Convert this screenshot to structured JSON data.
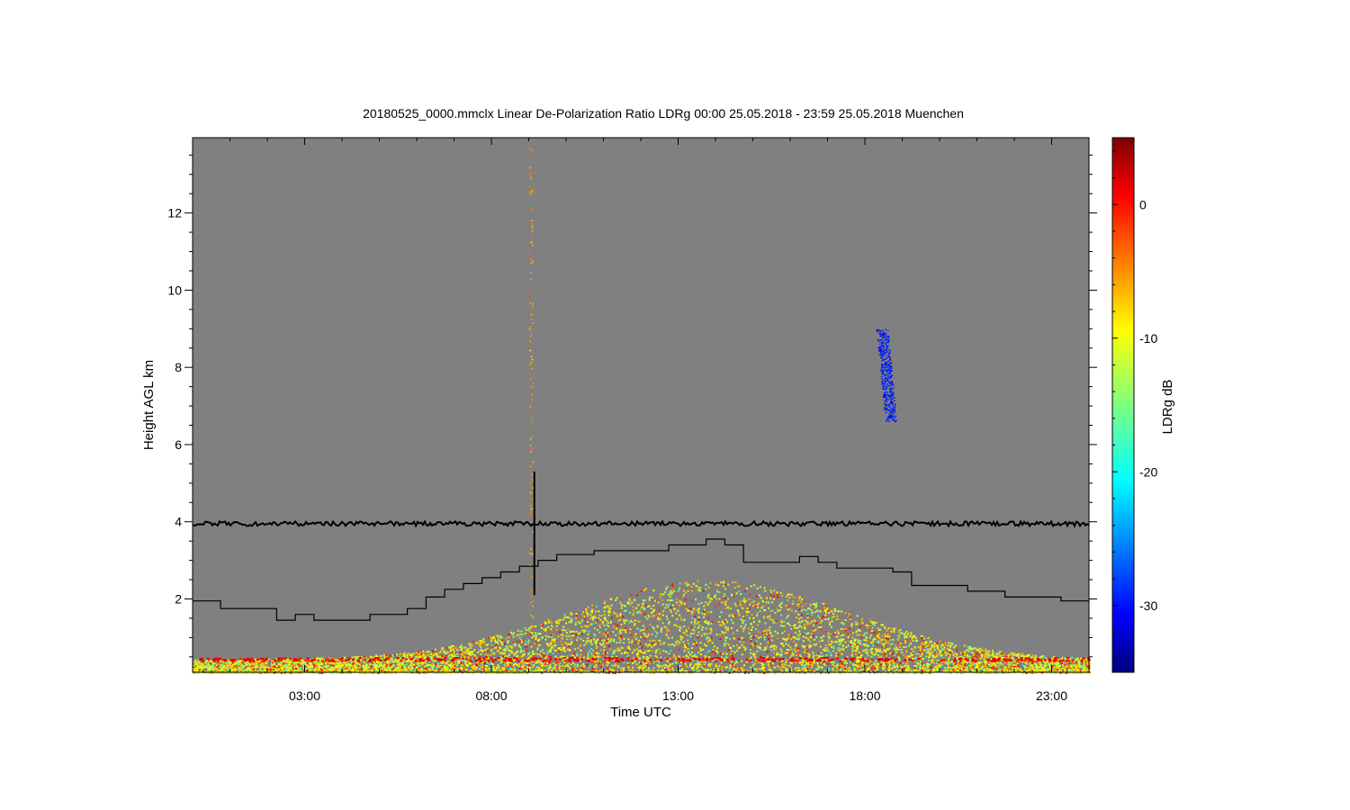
{
  "chart_data": {
    "type": "heatmap",
    "title": "20180525_0000.mmclx Linear De-Polarization Ratio LDRg   00:00 25.05.2018 - 23:59 25.05.2018 Muenchen",
    "xlabel": "Time UTC",
    "ylabel": "Height AGL km",
    "colorbar_label": "LDRg dB",
    "xlim_hours": [
      0.0,
      24.0
    ],
    "ylim_km": [
      0.1,
      13.95
    ],
    "x_ticks": [
      {
        "hours": 3,
        "label": "03:00"
      },
      {
        "hours": 8,
        "label": "08:00"
      },
      {
        "hours": 13,
        "label": "13:00"
      },
      {
        "hours": 18,
        "label": "18:00"
      },
      {
        "hours": 23,
        "label": "23:00"
      }
    ],
    "y_ticks": [
      {
        "km": 2,
        "label": "2"
      },
      {
        "km": 4,
        "label": "4"
      },
      {
        "km": 6,
        "label": "6"
      },
      {
        "km": 8,
        "label": "8"
      },
      {
        "km": 10,
        "label": "10"
      },
      {
        "km": 12,
        "label": "12"
      }
    ],
    "colorbar": {
      "range_db": [
        -35,
        5
      ],
      "ticks": [
        {
          "value": 0,
          "label": "0"
        },
        {
          "value": -10,
          "label": "-10"
        },
        {
          "value": -20,
          "label": "-20"
        },
        {
          "value": -30,
          "label": "-30"
        }
      ],
      "colormap": "jet"
    },
    "background_color": "#808080",
    "noise_line_km": 3.95,
    "boundary_layer_step_km": [
      [
        0.0,
        1.95
      ],
      [
        0.75,
        1.75
      ],
      [
        2.25,
        1.45
      ],
      [
        2.75,
        1.6
      ],
      [
        3.25,
        1.45
      ],
      [
        4.75,
        1.6
      ],
      [
        5.75,
        1.75
      ],
      [
        6.25,
        2.05
      ],
      [
        6.75,
        2.25
      ],
      [
        7.25,
        2.4
      ],
      [
        7.75,
        2.55
      ],
      [
        8.25,
        2.7
      ],
      [
        8.75,
        2.85
      ],
      [
        9.25,
        3.0
      ],
      [
        9.75,
        3.15
      ],
      [
        10.75,
        3.25
      ],
      [
        12.75,
        3.4
      ],
      [
        13.75,
        3.55
      ],
      [
        14.25,
        3.4
      ],
      [
        14.75,
        2.95
      ],
      [
        16.25,
        3.1
      ],
      [
        16.75,
        2.95
      ],
      [
        17.25,
        2.8
      ],
      [
        18.75,
        2.7
      ],
      [
        19.25,
        2.35
      ],
      [
        20.75,
        2.2
      ],
      [
        21.75,
        2.05
      ],
      [
        23.25,
        1.95
      ],
      [
        24.0,
        1.95
      ]
    ],
    "spike_hour": 9.15,
    "spike_km": [
      2.1,
      5.3
    ],
    "ice_cloud": {
      "hours": [
        18.3,
        18.8
      ],
      "km": [
        6.6,
        9.0
      ],
      "ldr_db": -31
    },
    "boundary_layer_echo": {
      "top_km": 2.4,
      "typical_ldr_db": -10
    }
  }
}
